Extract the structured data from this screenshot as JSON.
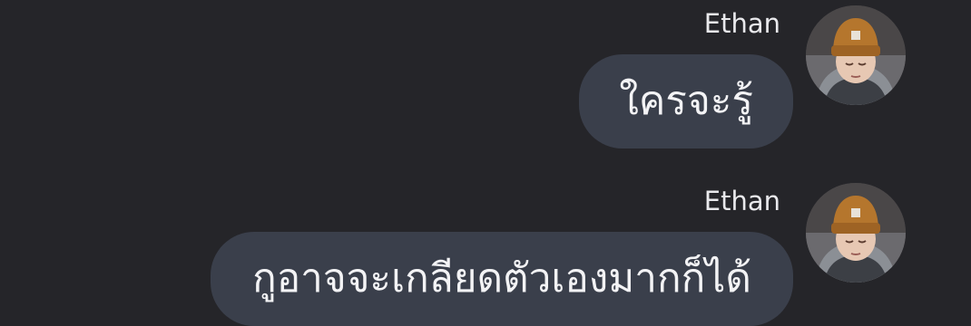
{
  "messages": [
    {
      "sender": "Ethan",
      "text": "ใครจะรู้",
      "avatar_icon": "profile-photo-beanie"
    },
    {
      "sender": "Ethan",
      "text": "กูอาจจะเกลียดตัวเองมากก็ได้",
      "avatar_icon": "profile-photo-beanie"
    }
  ],
  "colors": {
    "background": "#252529",
    "bubble": "#3a3f4b",
    "text": "#f3f3f5",
    "sender_name": "#e9e9ec",
    "beanie": "#b5762d"
  }
}
